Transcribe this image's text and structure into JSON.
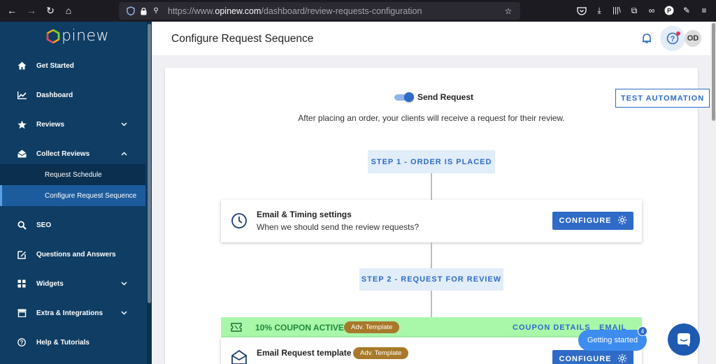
{
  "browser": {
    "url_proto": "https://www.",
    "url_host": "opinew.com",
    "url_path": "/dashboard/review-requests-configuration"
  },
  "sidebar": {
    "logo_text": "pinew",
    "items": [
      {
        "label": "Get Started",
        "icon": "home-icon"
      },
      {
        "label": "Dashboard",
        "icon": "chart-icon"
      },
      {
        "label": "Reviews",
        "icon": "star-icon"
      },
      {
        "label": "Collect Reviews",
        "icon": "envelope-icon"
      },
      {
        "label": "SEO",
        "icon": "search-icon"
      },
      {
        "label": "Questions and Answers",
        "icon": "edit-icon"
      },
      {
        "label": "Widgets",
        "icon": "widgets-icon"
      },
      {
        "label": "Extra & Integrations",
        "icon": "archive-icon"
      },
      {
        "label": "Help & Tutorials",
        "icon": "help-icon"
      }
    ],
    "sub_items": [
      {
        "label": "Request Schedule"
      },
      {
        "label": "Configure Request Sequence"
      }
    ]
  },
  "header": {
    "title": "Configure Request Sequence",
    "avatar_initials": "OD"
  },
  "main": {
    "toggle_label": "Send Request",
    "toggle_on": true,
    "intro": "After placing an order, your clients will receive a request for their review.",
    "test_button": "TEST AUTOMATION",
    "step1": "STEP 1 - ORDER IS PLACED",
    "step2": "STEP 2 - REQUEST FOR REVIEW",
    "timing": {
      "title": "Email & Timing settings",
      "subtitle": "When we should send the review requests?",
      "button": "CONFIGURE"
    },
    "coupon": {
      "text": "10% COUPON ACTIVE",
      "badge": "Adv. Template",
      "details_link": "COUPON DETAILS",
      "email_link": "EMAIL"
    },
    "email_template": {
      "title": "Email Request template",
      "badge": "Adv. Template",
      "button": "CONFIGURE"
    }
  },
  "widget": {
    "getting_started": "Getting started",
    "badge_count": "4"
  },
  "colors": {
    "sidebar_bg": "#0f3d63",
    "accent": "#2f6bc7",
    "coupon_bg": "#a9f7a9",
    "badge_bg": "#a8792a"
  }
}
